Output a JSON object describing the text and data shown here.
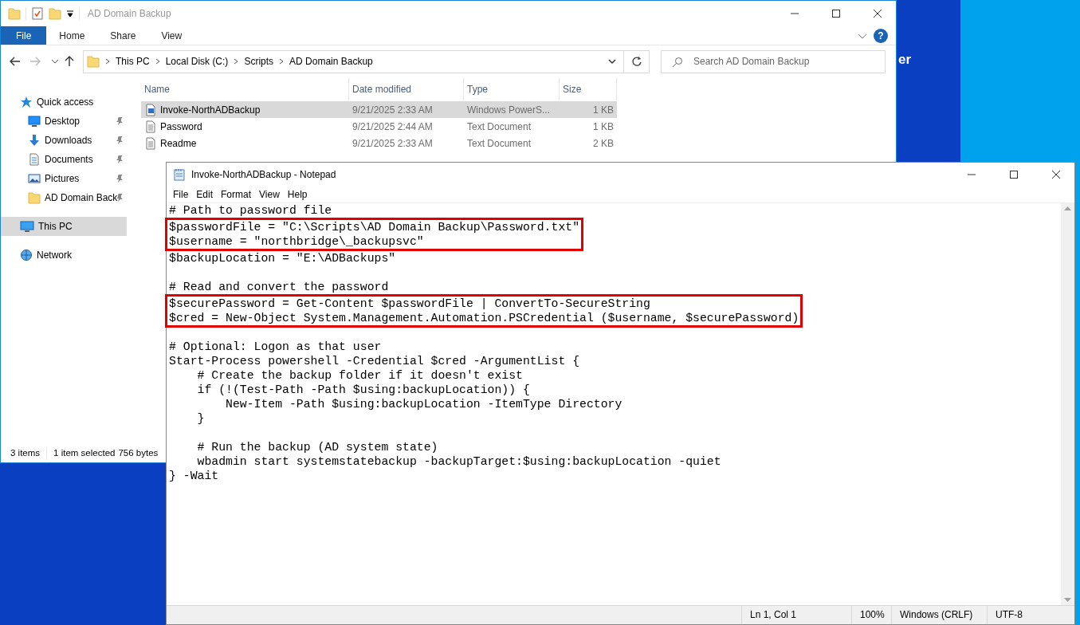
{
  "desktop": {
    "text": "er"
  },
  "explorer": {
    "title": "AD Domain Backup",
    "ribbon_tabs": [
      {
        "label": "File",
        "selected": true
      },
      {
        "label": "Home",
        "selected": false
      },
      {
        "label": "Share",
        "selected": false
      },
      {
        "label": "View",
        "selected": false
      }
    ],
    "help": "?",
    "breadcrumb": [
      "This PC",
      "Local Disk (C:)",
      "Scripts",
      "AD Domain Backup"
    ],
    "search": {
      "placeholder": "Search AD Domain Backup"
    },
    "nav": [
      {
        "label": "Quick access",
        "kind": "star",
        "selected": false,
        "children": [
          {
            "label": "Desktop",
            "kind": "desktop",
            "pinned": true,
            "selected": false
          },
          {
            "label": "Downloads",
            "kind": "download",
            "pinned": true,
            "selected": false
          },
          {
            "label": "Documents",
            "kind": "document",
            "pinned": true,
            "selected": false
          },
          {
            "label": "Pictures",
            "kind": "picture",
            "pinned": true,
            "selected": false
          },
          {
            "label": "AD Domain Back",
            "kind": "folder",
            "pinned": true,
            "selected": false
          }
        ]
      },
      {
        "label": "This PC",
        "kind": "pc",
        "selected": true
      },
      {
        "label": "Network",
        "kind": "network",
        "selected": false
      }
    ],
    "columns": [
      "Name",
      "Date modified",
      "Type",
      "Size"
    ],
    "files": [
      {
        "name": "Invoke-NorthADBackup",
        "date": "9/21/2025 2:33 AM",
        "type": "Windows PowerS...",
        "size": "1 KB",
        "kind": "script",
        "selected": true
      },
      {
        "name": "Password",
        "date": "9/21/2025 2:44 AM",
        "type": "Text Document",
        "size": "1 KB",
        "kind": "text",
        "selected": false
      },
      {
        "name": "Readme",
        "date": "9/21/2025 2:33 AM",
        "type": "Text Document",
        "size": "2 KB",
        "kind": "text",
        "selected": false
      }
    ],
    "status": [
      "3 items",
      "1 item selected",
      "756 bytes"
    ]
  },
  "notepad": {
    "title": "Invoke-NorthADBackup - Notepad",
    "menu": [
      "File",
      "Edit",
      "Format",
      "View",
      "Help"
    ],
    "paragraphs": [
      [
        {
          "highlighted": false,
          "lines": [
            "# Path to password file"
          ]
        },
        {
          "highlighted": true,
          "lines": [
            "$passwordFile = \"C:\\Scripts\\AD Domain Backup\\Password.txt\"",
            "$username = \"northbridge\\_backupsvc\""
          ]
        },
        {
          "highlighted": false,
          "lines": [
            "$backupLocation = \"E:\\ADBackups\""
          ]
        }
      ],
      [
        {
          "highlighted": false,
          "lines": [
            "# Read and convert the password"
          ]
        },
        {
          "highlighted": true,
          "lines": [
            "$securePassword = Get-Content $passwordFile | ConvertTo-SecureString",
            "$cred = New-Object System.Management.Automation.PSCredential ($username, $securePassword)"
          ]
        }
      ],
      [
        {
          "highlighted": false,
          "lines": [
            "# Optional: Logon as that user",
            "Start-Process powershell -Credential $cred -ArgumentList {",
            "    # Create the backup folder if it doesn't exist",
            "    if (!(Test-Path -Path $using:backupLocation)) {",
            "        New-Item -Path $using:backupLocation -ItemType Directory",
            "    }"
          ]
        }
      ],
      [
        {
          "highlighted": false,
          "lines": [
            "    # Run the backup (AD system state)",
            "    wbadmin start systemstatebackup -backupTarget:$using:backupLocation -quiet",
            "} -Wait"
          ]
        }
      ]
    ],
    "status": [
      "Ln 1, Col 1",
      "100%",
      "Windows (CRLF)",
      "UTF-8"
    ]
  }
}
